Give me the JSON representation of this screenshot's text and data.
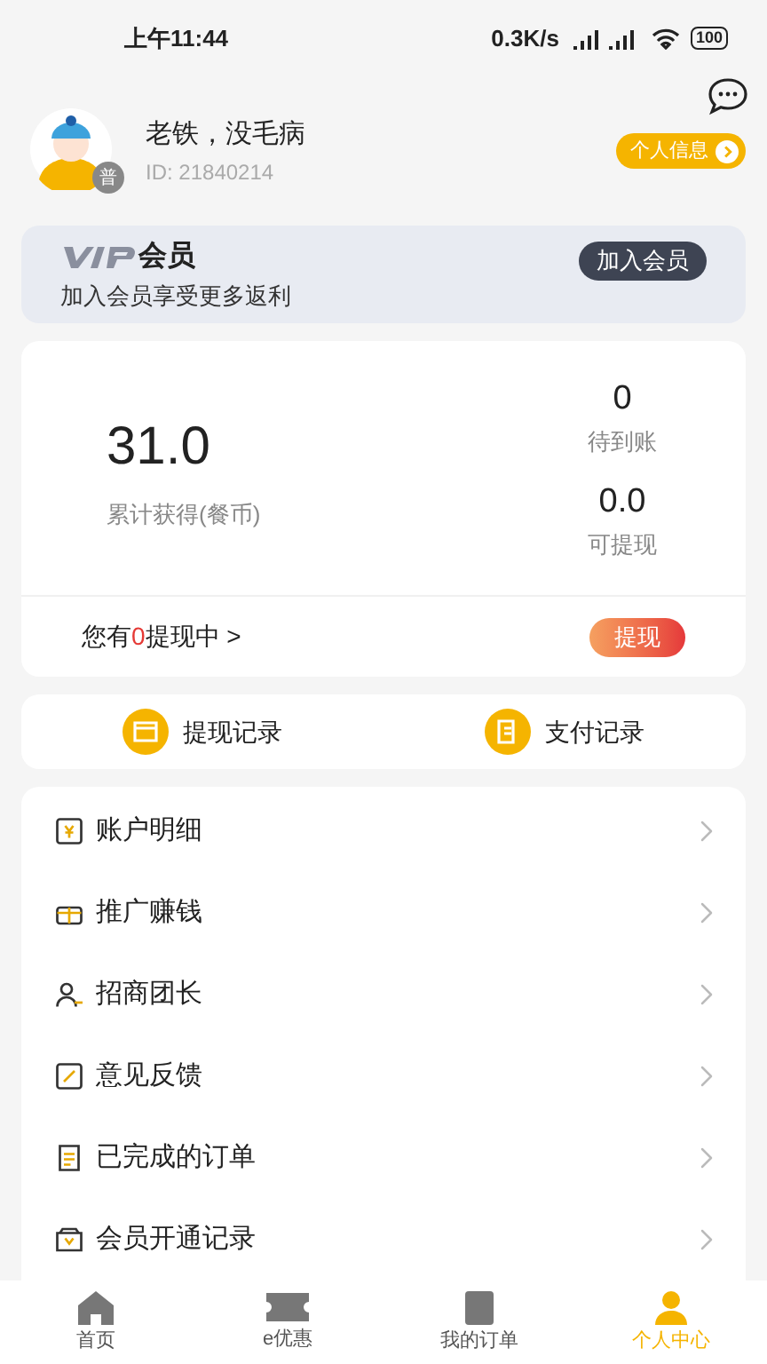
{
  "status_bar": {
    "time": "上午11:44",
    "speed": "0.3K/s",
    "battery": "100"
  },
  "profile": {
    "name": "老铁，没毛病",
    "id": "ID: 21840214",
    "level_badge": "普",
    "info_button": "个人信息"
  },
  "vip": {
    "title": "会员",
    "subtitle": "加入会员享受更多返利",
    "button": "加入会员"
  },
  "earnings": {
    "total": "31.0",
    "total_label": "累计获得(餐币)",
    "pending": "0",
    "pending_label": "待到账",
    "withdrawable": "0.0",
    "withdrawable_label": "可提现",
    "withdrawing_prefix": "您有",
    "withdrawing_count": "0",
    "withdrawing_suffix": "提现中 >",
    "withdraw_button": "提现"
  },
  "records": [
    {
      "kind": "withdraw",
      "label": "提现记录"
    },
    {
      "kind": "pay",
      "label": "支付记录"
    }
  ],
  "menu": [
    {
      "kind": "account",
      "label": "账户明细"
    },
    {
      "kind": "promote",
      "label": "推广赚钱"
    },
    {
      "kind": "recruit",
      "label": "招商团长"
    },
    {
      "kind": "feedback",
      "label": "意见反馈"
    },
    {
      "kind": "orders",
      "label": "已完成的订单"
    },
    {
      "kind": "vip",
      "label": "会员开通记录"
    }
  ],
  "tabs": [
    {
      "kind": "home",
      "label": "首页",
      "selected": false
    },
    {
      "kind": "coupon",
      "label": "e优惠",
      "selected": false
    },
    {
      "kind": "orders",
      "label": "我的订单",
      "selected": false
    },
    {
      "kind": "me",
      "label": "个人中心",
      "selected": true
    }
  ]
}
